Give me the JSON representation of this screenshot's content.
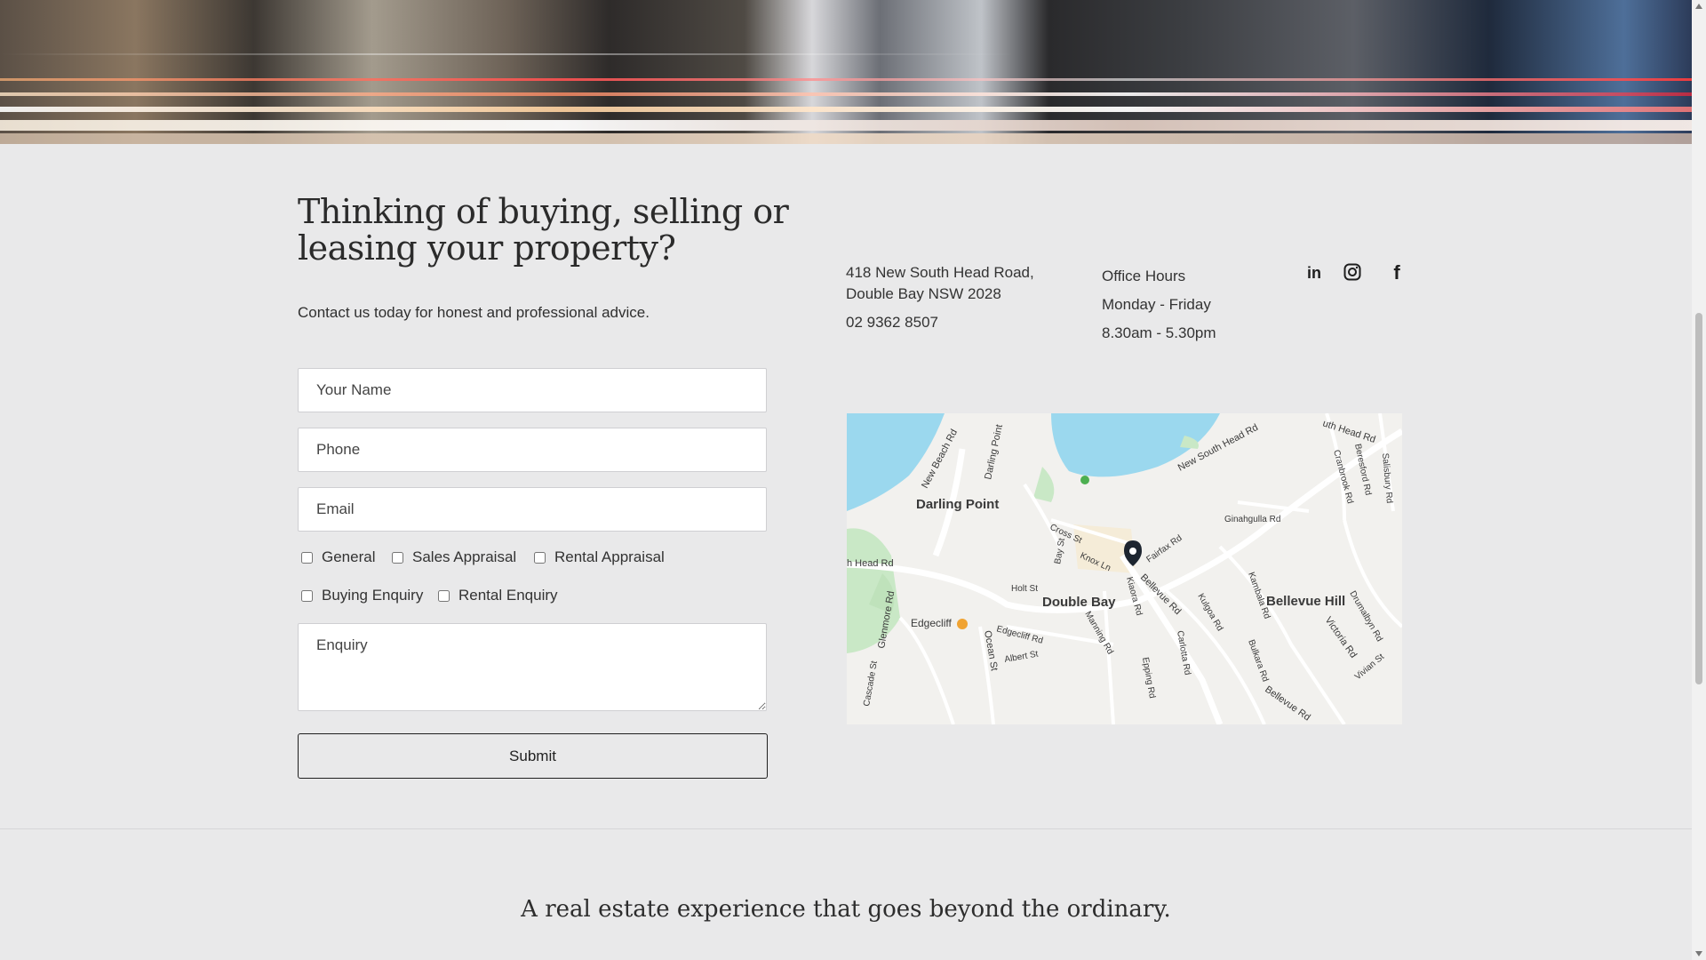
{
  "hero": {
    "image_name": "street-light-trails-photo"
  },
  "contact": {
    "headline": "Thinking of buying, selling or leasing your property?",
    "subtext": "Contact us today for honest and professional advice.",
    "form": {
      "name_placeholder": "Your Name",
      "phone_placeholder": "Phone",
      "email_placeholder": "Email",
      "enquiry_placeholder": "Enquiry",
      "checkboxes": [
        {
          "label": "General",
          "checked": false
        },
        {
          "label": "Sales Appraisal",
          "checked": false
        },
        {
          "label": "Rental Appraisal",
          "checked": false
        },
        {
          "label": "Buying Enquiry",
          "checked": false
        },
        {
          "label": "Rental Enquiry",
          "checked": false
        }
      ],
      "submit_label": "Submit"
    }
  },
  "office": {
    "address_line1": "418 New South Head Road,",
    "address_line2": "Double Bay NSW 2028",
    "phone": "02 9362 8507",
    "hours_title": "Office Hours",
    "hours_days": "Monday - Friday",
    "hours_time": "8.30am - 5.30pm"
  },
  "social": {
    "linkedin": "in",
    "instagram": "instagram-icon",
    "facebook": "f"
  },
  "map": {
    "labels": {
      "darling_point": "Darling Point",
      "double_bay": "Double Bay",
      "bellevue_hill": "Bellevue Hill",
      "edgecliff": "Edgecliff",
      "new_beach_rd": "New Beach Rd",
      "darling_point_rd": "Darling Point",
      "new_south_head_rd": "New South Head Rd",
      "south_head_rd_top": "uth Head Rd",
      "head_rd_left": "h Head Rd",
      "bellevue_rd": "Bellevue Rd",
      "kiaora_rd": "Kiaora Rd",
      "glenmore_rd": "Glenmore Rd",
      "ocean_st": "Ocean St",
      "edgecliff_rd": "Edgecliff Rd",
      "victoria_rd": "Victoria Rd",
      "ginahgulla_rd": "Ginahgulla Rd",
      "cross_st": "Cross St",
      "knox_ln": "Knox Ln",
      "fairfax_rd": "Fairfax Rd",
      "holt_st": "Holt St",
      "albert_st": "Albert St",
      "kambala_rd": "Kambala Rd",
      "cranbrook_rd": "Cranbrook Rd",
      "beresford_rd": "Beresford Rd",
      "salisbury_rd": "Salisbury Rd",
      "carlotta_rd": "Carlotta Rd",
      "epping_rd": "Epping Rd",
      "manning_rd": "Manning Rd",
      "cascade_st": "Cascade St",
      "drumalbyn_rd": "Drumalbyn Rd",
      "bellevue_rd_lower": "Bellevue Rd",
      "vivian_st": "Vivian St",
      "bulkara_rd": "Bulkara Rd",
      "kulgoa_rd": "Kulgoa Rd",
      "bay_st": "Bay St"
    },
    "colors": {
      "water": "#9bd8ee",
      "park": "#c9e8c6",
      "land": "#f2f1ee"
    }
  },
  "footer": {
    "tagline": "A real estate experience that goes beyond the ordinary."
  }
}
